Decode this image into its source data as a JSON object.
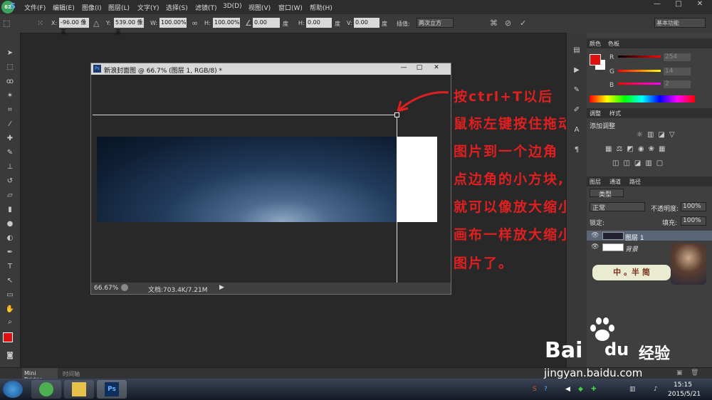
{
  "app": {
    "logo_text": "S",
    "badge": "62"
  },
  "menu": [
    "文件(F)",
    "编辑(E)",
    "图像(I)",
    "图层(L)",
    "文字(Y)",
    "选择(S)",
    "滤镜(T)",
    "3D(D)",
    "视图(V)",
    "窗口(W)",
    "帮助(H)"
  ],
  "window_controls": [
    "—",
    "□",
    "✕"
  ],
  "options": {
    "x_label": "X:",
    "x_value": "-96.00 像素",
    "y_label": "Y:",
    "y_value": "539.00 像素",
    "w_label": "W:",
    "w_value": "100.00%",
    "h_label": "H:",
    "h_value": "100.00%",
    "angle_value": "0.00",
    "angle_unit": "度",
    "hskew_label": "H:",
    "hskew_value": "0.00",
    "hskew_unit": "度",
    "vskew_label": "V:",
    "vskew_value": "0.00",
    "vskew_unit": "度",
    "interp_label": "插值:",
    "interp_value": "两次立方",
    "workspace": "基本功能"
  },
  "document": {
    "title": "新浪封面图 @ 66.7% (图层 1, RGB/8) *",
    "zoom": "66.67%",
    "doc_info": "文档:703.4K/7.21M"
  },
  "annotation": {
    "lines": [
      "按ctrl+T以后",
      "鼠标左键按住拖动",
      "图片到一个边角",
      "点边角的小方块,",
      "就可以像放大缩小",
      "画布一样放大缩小",
      "图片了。"
    ]
  },
  "color_panel": {
    "tabs": [
      "颜色",
      "色板"
    ],
    "r_label": "R",
    "r_value": "254",
    "g_label": "G",
    "g_value": "14",
    "b_label": "B",
    "b_value": "2",
    "foreground": "#fe0e02"
  },
  "adjust_panel": {
    "tabs": [
      "调整",
      "样式"
    ],
    "title": "添加调整"
  },
  "layers_panel": {
    "tabs": [
      "图层",
      "通道",
      "路径"
    ],
    "filter": "类型",
    "mode": "正常",
    "opacity_label": "不透明度:",
    "opacity_value": "100%",
    "lock_label": "锁定:",
    "fill_label": "填充:",
    "fill_value": "100%",
    "layers": [
      {
        "name": "图层 1"
      },
      {
        "name": "背景"
      }
    ]
  },
  "bottom": {
    "tabs": [
      "Mini Bridge",
      "时间轴"
    ]
  },
  "watermark": {
    "brand": "Bai",
    "brand_cn": "经验",
    "url": "jingyan.baidu.com",
    "sticker": "中 。半 简"
  },
  "taskbar": {
    "time": "15:15",
    "date": "2015/5/21",
    "ps_label": "Ps"
  }
}
